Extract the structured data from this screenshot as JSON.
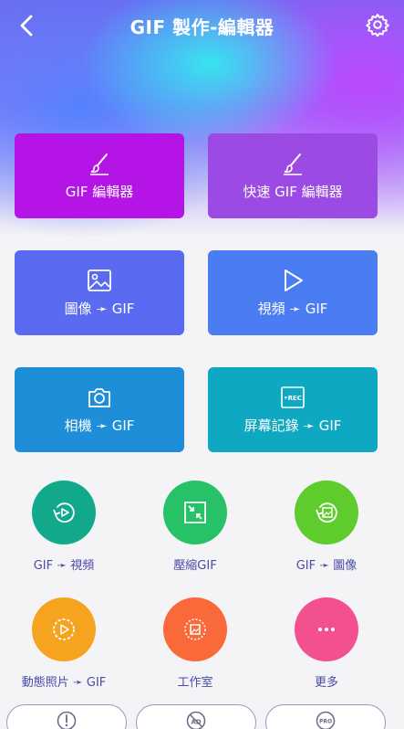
{
  "header": {
    "title": "GIF 製作-編輯器"
  },
  "cards": [
    {
      "label": "GIF 編輯器",
      "icon": "brush-icon",
      "color": "#b414e6"
    },
    {
      "label": "快速 GIF 編輯器",
      "icon": "brush-icon",
      "color": "#9b4be3"
    },
    {
      "label": "圖像 ➛ GIF",
      "icon": "image-icon",
      "color": "#5a6bf2"
    },
    {
      "label": "視頻 ➛ GIF",
      "icon": "play-icon",
      "color": "#4a7cf2"
    },
    {
      "label": "相機 ➛ GIF",
      "icon": "camera-icon",
      "color": "#1f8ed9"
    },
    {
      "label": "屏幕記錄 ➛ GIF",
      "icon": "rec-icon",
      "rec_text": "•REC",
      "color": "#0fa8c2"
    }
  ],
  "tools": [
    {
      "label": "GIF ➛ 視頻",
      "icon": "gif-to-video-icon",
      "color": "#12a98a"
    },
    {
      "label": "壓縮GIF",
      "icon": "compress-icon",
      "color": "#27c267"
    },
    {
      "label": "GIF ➛ 圖像",
      "icon": "gif-to-image-icon",
      "color": "#5dcc2c"
    },
    {
      "label": "動態照片 ➛ GIF",
      "icon": "live-photo-icon",
      "color": "#f6a31f"
    },
    {
      "label": "工作室",
      "icon": "studio-icon",
      "color": "#f9693a"
    },
    {
      "label": "更多",
      "icon": "more-icon",
      "color": "#f2508f"
    }
  ],
  "bottom": {
    "items": [
      {
        "icon": "feedback-icon"
      },
      {
        "icon": "no-ads-icon",
        "text": "AD"
      },
      {
        "icon": "pro-icon",
        "text": "PRO"
      }
    ]
  }
}
